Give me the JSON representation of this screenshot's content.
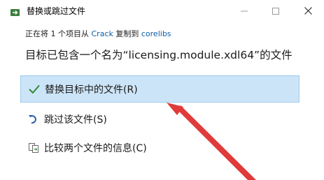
{
  "window": {
    "title": "替换或跳过文件",
    "icon": "copy-folder-icon"
  },
  "controls": {
    "minimize_icon": "minimize-icon",
    "maximize_icon": "maximize-icon",
    "close_icon": "close-icon"
  },
  "info": {
    "prefix": "正在将 1 个项目从",
    "source": "Crack",
    "middle": "复制到",
    "destination": "corelibs"
  },
  "heading": "目标已包含一个名为“licensing.module.xdl64”的文件",
  "options": [
    {
      "label": "替换目标中的文件(R)",
      "icon": "checkmark-icon",
      "selected": true
    },
    {
      "label": "跳过该文件(S)",
      "icon": "skip-arrow-icon",
      "selected": false
    },
    {
      "label": "比较两个文件的信息(C)",
      "icon": "compare-files-icon",
      "selected": false
    }
  ],
  "colors": {
    "selection_bg": "#cce4f7",
    "selection_border": "#9ccbee",
    "link": "#0a5ea8",
    "check": "#2e8b2e",
    "annotation_arrow": "#e03a3a"
  }
}
